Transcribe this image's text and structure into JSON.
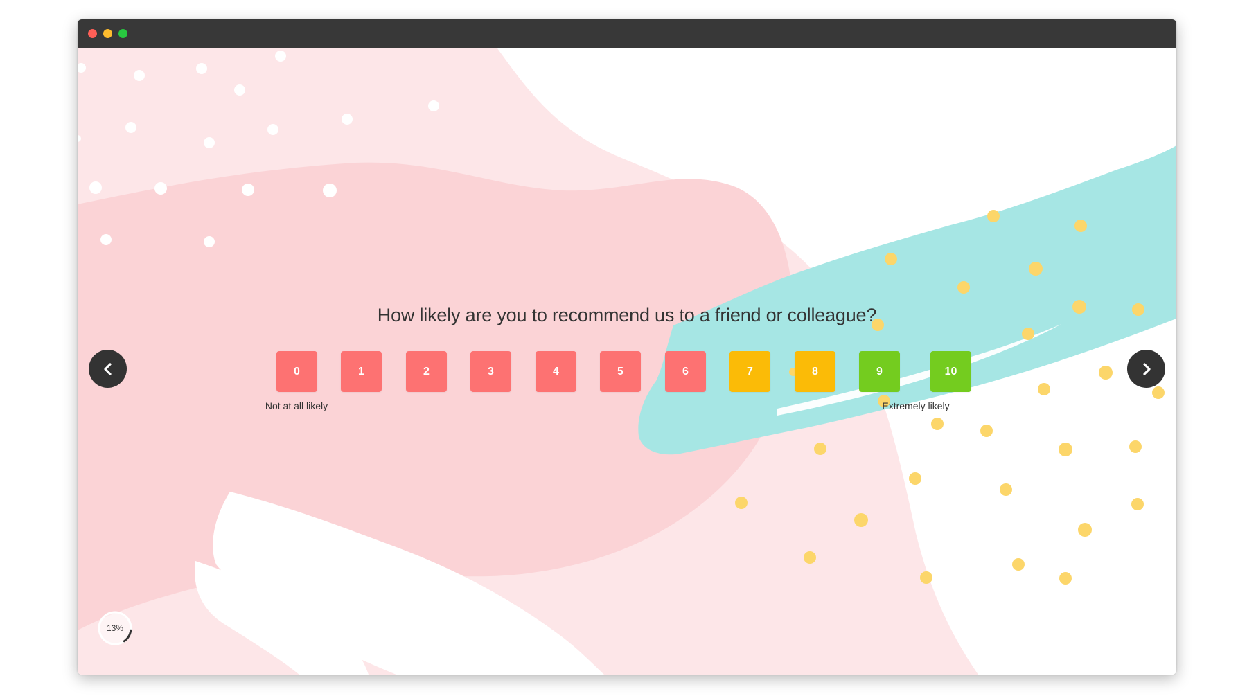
{
  "survey": {
    "question": "How likely are you to recommend us to a friend or colleague?",
    "scale": [
      {
        "label": "0",
        "color": "#fd7272"
      },
      {
        "label": "1",
        "color": "#fd7272"
      },
      {
        "label": "2",
        "color": "#fd7272"
      },
      {
        "label": "3",
        "color": "#fd7272"
      },
      {
        "label": "4",
        "color": "#fd7272"
      },
      {
        "label": "5",
        "color": "#fd7272"
      },
      {
        "label": "6",
        "color": "#fd7272"
      },
      {
        "label": "7",
        "color": "#fbbb07"
      },
      {
        "label": "8",
        "color": "#fbbb07"
      },
      {
        "label": "9",
        "color": "#74cc1f"
      },
      {
        "label": "10",
        "color": "#74cc1f"
      }
    ],
    "low_label": "Not at all likely",
    "high_label": "Extremely likely"
  },
  "navigation": {
    "prev_icon": "chevron-left-icon",
    "next_icon": "chevron-right-icon"
  },
  "progress": {
    "text": "13%",
    "value": 13
  },
  "theme": {
    "titlebar": "#383838",
    "pink_light": "#fde6e8",
    "pink": "#fbd3d6",
    "teal": "#a6e6e4",
    "dots_yellow": "#fcd66a",
    "nav_button": "#333333"
  }
}
